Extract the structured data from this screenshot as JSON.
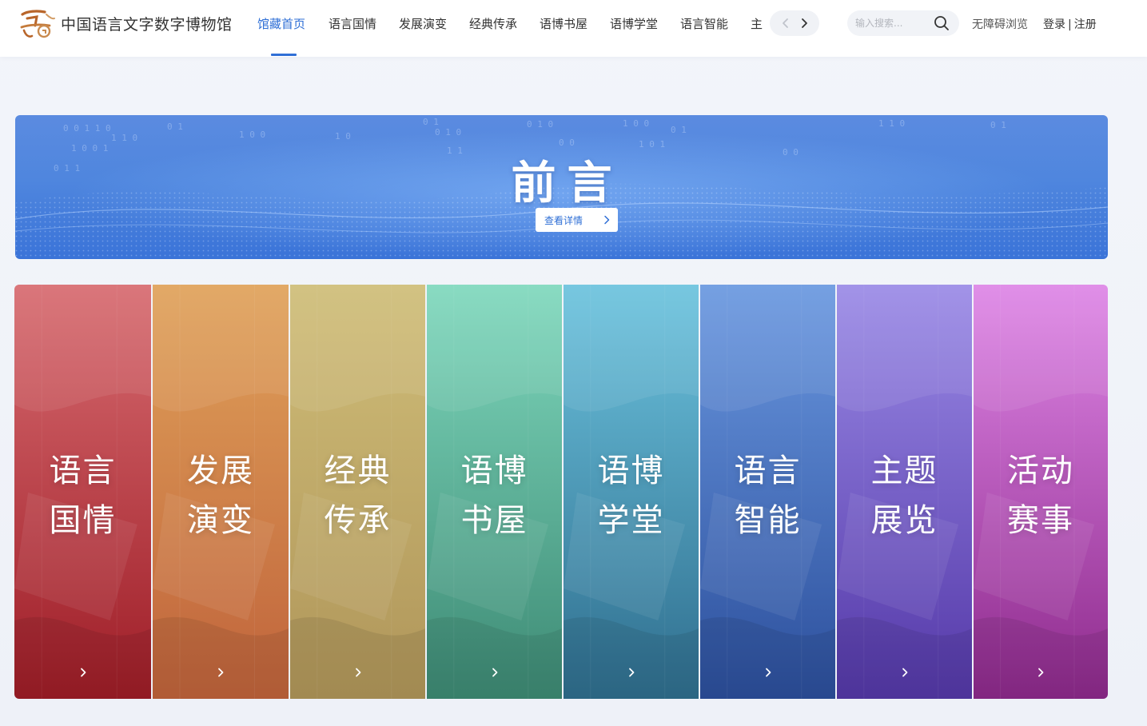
{
  "header": {
    "site_title": "中国语言文字数字博物馆",
    "logo_icon": "yu-calligraphy-logo",
    "nav": [
      {
        "label": "馆藏首页",
        "active": true
      },
      {
        "label": "语言国情",
        "active": false
      },
      {
        "label": "发展演变",
        "active": false
      },
      {
        "label": "经典传承",
        "active": false
      },
      {
        "label": "语博书屋",
        "active": false
      },
      {
        "label": "语博学堂",
        "active": false
      },
      {
        "label": "语言智能",
        "active": false
      },
      {
        "label": "主",
        "active": false
      }
    ],
    "search_placeholder": "输入搜索...",
    "accessible_label": "无障碍浏览",
    "login_label": "登录",
    "separator": "|",
    "register_label": "注册",
    "accent_color": "#2f6fd6"
  },
  "banner": {
    "title": "前言",
    "button_label": "查看详情"
  },
  "cards": [
    {
      "line1": "语言",
      "line2": "国情",
      "color_top": "#d76b70",
      "color_bottom": "#9e1d27"
    },
    {
      "line1": "发展",
      "line2": "演变",
      "color_top": "#e0a25a",
      "color_bottom": "#c0633b"
    },
    {
      "line1": "经典",
      "line2": "传承",
      "color_top": "#cfbd78",
      "color_bottom": "#b0965a"
    },
    {
      "line1": "语博",
      "line2": "书屋",
      "color_top": "#7fd8bd",
      "color_bottom": "#3d8a74"
    },
    {
      "line1": "语博",
      "line2": "学堂",
      "color_top": "#6cc3de",
      "color_bottom": "#2f6e8e"
    },
    {
      "line1": "语言",
      "line2": "智能",
      "color_top": "#6a98e0",
      "color_bottom": "#2c4f9c"
    },
    {
      "line1": "主题",
      "line2": "展览",
      "color_top": "#9a8ae6",
      "color_bottom": "#5438a8"
    },
    {
      "line1": "活动",
      "line2": "赛事",
      "color_top": "#de86e6",
      "color_bottom": "#8e2a8c"
    }
  ]
}
